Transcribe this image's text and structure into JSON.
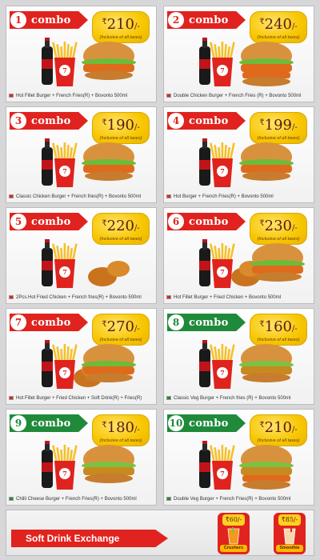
{
  "combos": [
    {
      "number": "1",
      "word": "combo",
      "price": "210",
      "rs": "₹",
      "suffix": "/-",
      "tax": "(Inclusive of all taxes)",
      "theme": "red",
      "caption": "Hot Fillet Burger + French Fries(R) + Bovonto 500ml",
      "veg": false
    },
    {
      "number": "2",
      "word": "combo",
      "price": "240",
      "rs": "₹",
      "suffix": "/-",
      "tax": "(Inclusive of all taxes)",
      "theme": "red",
      "caption": "Double Chicken Burger + French Fries (R) + Bovonto 500ml",
      "veg": false
    },
    {
      "number": "3",
      "word": "combo",
      "price": "190",
      "rs": "₹",
      "suffix": "/-",
      "tax": "(Inclusive of all taxes)",
      "theme": "red",
      "caption": "Classic Chicken Burger + French fries(R) + Bovonto 500ml",
      "veg": false
    },
    {
      "number": "4",
      "word": "combo",
      "price": "199",
      "rs": "₹",
      "suffix": "/-",
      "tax": "(Inclusive of all taxes)",
      "theme": "red",
      "caption": "Hot Burger + French Fries(R) + Bovonto 500ml",
      "veg": false
    },
    {
      "number": "5",
      "word": "combo",
      "price": "220",
      "rs": "₹",
      "suffix": "/-",
      "tax": "(Inclusive of all taxes)",
      "theme": "red",
      "caption": "2Pcs.Hot Fried Chicken + French fries(R) + Bovonto 500ml",
      "veg": false
    },
    {
      "number": "6",
      "word": "combo",
      "price": "230",
      "rs": "₹",
      "suffix": "/-",
      "tax": "(Inclusive of all taxes)",
      "theme": "red",
      "caption": "Hot Fillet Burger + Fried Chicken + Bovonto 500ml",
      "veg": false
    },
    {
      "number": "7",
      "word": "combo",
      "price": "270",
      "rs": "₹",
      "suffix": "/-",
      "tax": "(Inclusive of all taxes)",
      "theme": "red",
      "caption": "Hot Fillet Burger + Fried Chicken + Soft Drink(R) + Fries(R)",
      "veg": false
    },
    {
      "number": "8",
      "word": "combo",
      "price": "160",
      "rs": "₹",
      "suffix": "/-",
      "tax": "(Inclusive of all taxes)",
      "theme": "green",
      "caption": "Classic Veg Burger + French fries (R) + Bovonto 500ml",
      "veg": true
    },
    {
      "number": "9",
      "word": "combo",
      "price": "180",
      "rs": "₹",
      "suffix": "/-",
      "tax": "(Inclusive of all taxes)",
      "theme": "green",
      "caption": "Chilli Cheese Burger + French Fries(R) + Bovonto 500ml",
      "veg": true
    },
    {
      "number": "10",
      "word": "combo",
      "price": "210",
      "rs": "₹",
      "suffix": "/-",
      "tax": "(Inclusive of all taxes)",
      "theme": "green",
      "caption": "Double Veg Burger + French Fries(R) + Bovonto 500ml",
      "veg": true
    }
  ],
  "footer": {
    "exchange_label": "Soft Drink Exchange",
    "options": [
      {
        "price": "₹60/-",
        "label": "Crushers"
      },
      {
        "price": "₹85/-",
        "label": "Smoothie"
      }
    ]
  },
  "colors": {
    "red": "#e0231e",
    "green": "#1f8a3a",
    "gold": "#f7c600",
    "background": "#d7d7d9"
  }
}
